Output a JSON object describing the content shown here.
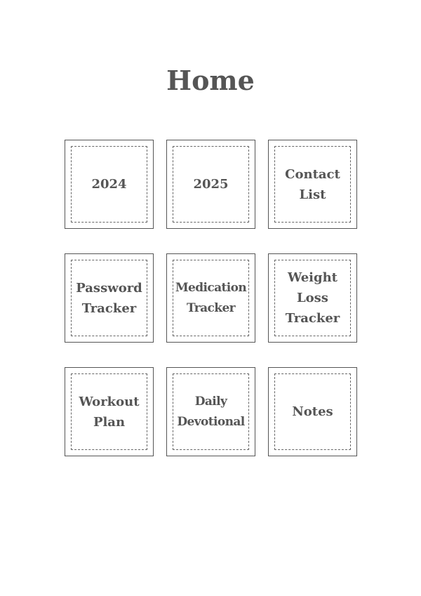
{
  "page": {
    "title": "Home"
  },
  "tiles": [
    {
      "label": "2024"
    },
    {
      "label": "2025"
    },
    {
      "label": "Contact\nList"
    },
    {
      "label": "Password\nTracker"
    },
    {
      "label": "Medication\nTracker"
    },
    {
      "label": "Weight\nLoss\nTracker"
    },
    {
      "label": "Workout\nPlan"
    },
    {
      "label": "Daily\nDevotional"
    },
    {
      "label": "Notes"
    }
  ]
}
